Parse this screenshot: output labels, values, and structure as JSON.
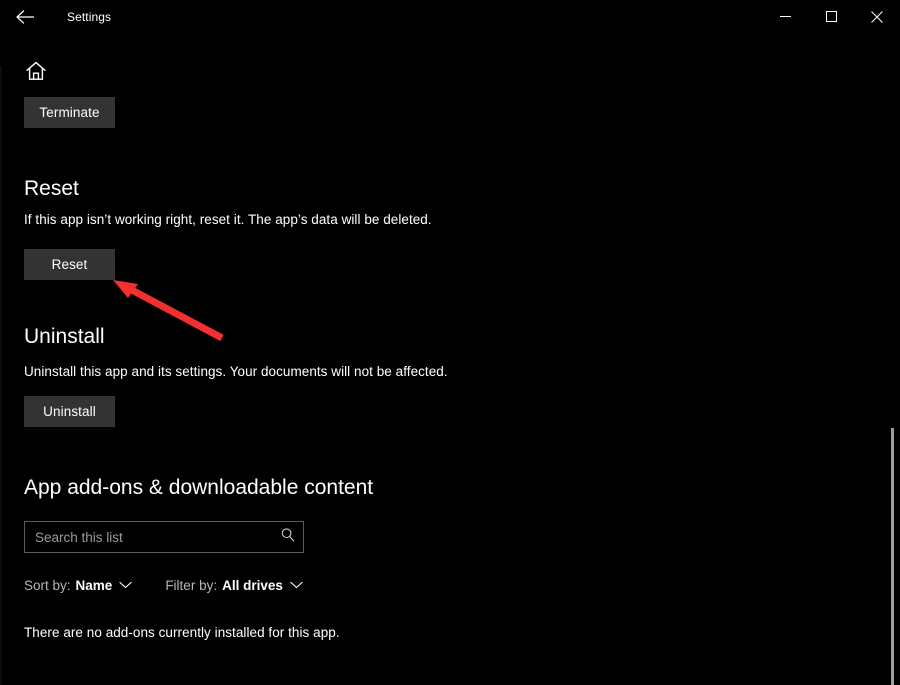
{
  "window": {
    "title": "Settings",
    "back_icon": "back-arrow-icon",
    "minimize_icon": "minimize-icon",
    "maximize_icon": "maximize-icon",
    "close_icon": "close-icon"
  },
  "nav": {
    "home_icon": "home-icon"
  },
  "terminate": {
    "button_label": "Terminate"
  },
  "reset": {
    "heading": "Reset",
    "description": "If this app isn’t working right, reset it. The app’s data will be deleted.",
    "button_label": "Reset"
  },
  "uninstall": {
    "heading": "Uninstall",
    "description": "Uninstall this app and its settings. Your documents will not be affected.",
    "button_label": "Uninstall"
  },
  "addons": {
    "heading": "App add-ons & downloadable content",
    "search": {
      "value": "",
      "placeholder": "Search this list",
      "icon": "search-icon"
    },
    "sort_by": {
      "label": "Sort by:",
      "value": "Name",
      "chevron_icon": "chevron-down-icon"
    },
    "filter_by": {
      "label": "Filter by:",
      "value": "All drives",
      "chevron_icon": "chevron-down-icon"
    },
    "empty_message": "There are no add-ons currently installed for this app."
  },
  "annotation": {
    "arrow_color": "#f23030",
    "arrow_name": "red-annotation-arrow"
  },
  "theme": {
    "background": "#000000",
    "button_background": "#333333",
    "text": "#ffffff",
    "muted_text": "#b6b6b6",
    "border": "#5c5c5c",
    "scrollbar_thumb": "#9d9d9d"
  }
}
